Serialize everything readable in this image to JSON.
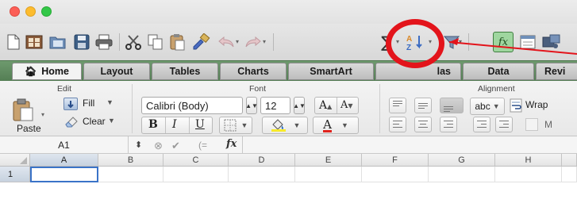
{
  "toolbar": {
    "icons": [
      "new-document-icon",
      "templates-icon",
      "open-icon",
      "save-icon",
      "print-icon",
      "cut-icon",
      "copy-icon",
      "paste-icon",
      "format-painter-icon",
      "undo-icon",
      "redo-icon",
      "autosum-icon",
      "sort-icon",
      "filter-icon",
      "function-icon",
      "show-hide-icon",
      "media-icon"
    ],
    "fx_label": "fx"
  },
  "ribbon_tabs": [
    "Home",
    "Layout",
    "Tables",
    "Charts",
    "SmartArt",
    "Formulas",
    "Data",
    "Revi"
  ],
  "ribbon_tab_formulas_visible": "las",
  "groups": {
    "edit": {
      "title": "Edit",
      "paste_label": "Paste",
      "fill_label": "Fill",
      "clear_label": "Clear"
    },
    "font": {
      "title": "Font",
      "font_name": "Calibri (Body)",
      "font_size": "12",
      "grow_label": "A",
      "shrink_label": "A",
      "bold": "B",
      "italic": "I",
      "underline": "U",
      "font_color_label": "A"
    },
    "alignment": {
      "title": "Alignment",
      "orientation_label": "abc",
      "wrap_label": "Wrap",
      "merge_label": "M"
    }
  },
  "formula_bar": {
    "name_box": "A1",
    "fx": "fx",
    "value": ""
  },
  "grid": {
    "columns": [
      "A",
      "B",
      "C",
      "D",
      "E",
      "F",
      "G",
      "H"
    ],
    "rows": [
      "1"
    ],
    "active_cell": "A1"
  },
  "annotation": {
    "circle_color": "#e3141b",
    "arrow_color": "#e3141b"
  }
}
